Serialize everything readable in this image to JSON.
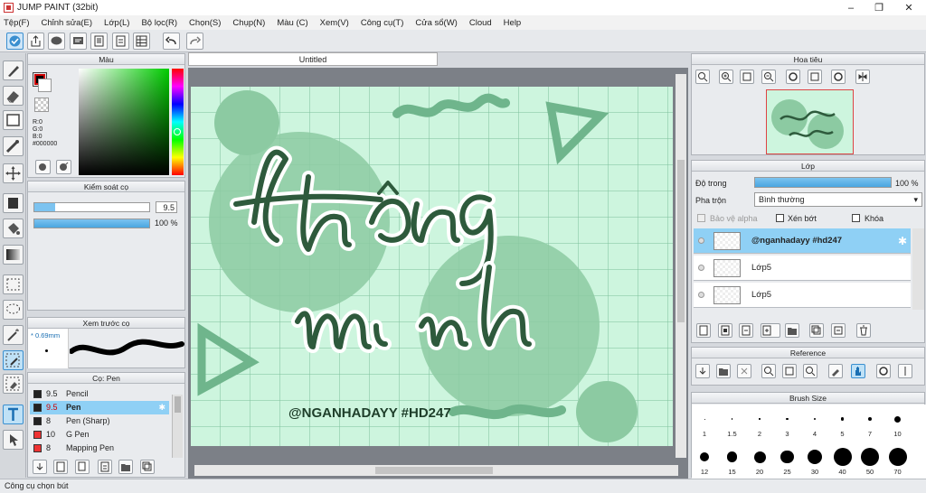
{
  "window": {
    "title": "JUMP PAINT (32bit)",
    "controls": [
      "minimize",
      "restore",
      "close"
    ]
  },
  "menu": [
    "Tệp(F)",
    "Chỉnh sửa(E)",
    "Lớp(L)",
    "Bộ lọc(R)",
    "Chọn(S)",
    "Chụp(N)",
    "Màu (C)",
    "Xem(V)",
    "Công cụ(T)",
    "Cửa sổ(W)",
    "Cloud",
    "Help"
  ],
  "document": {
    "tab_title": "Untitled"
  },
  "color_panel": {
    "title": "Màu",
    "r": "R:0",
    "g": "G:0",
    "b": "B:0",
    "hex": "#000000",
    "primary": "#000000",
    "secondary": "#ffffff"
  },
  "brush_control": {
    "title": "Kiểm soát cọ",
    "size": "9.5",
    "size_fraction": 0.18,
    "opacity": "100 %"
  },
  "brush_preview": {
    "title": "Xem trước cọ",
    "size_label": "* 0.69mm"
  },
  "brush_list": {
    "title": "Cọ: Pen",
    "items": [
      {
        "size": "9.5",
        "name": "Pencil",
        "color": "#222222",
        "selected": false
      },
      {
        "size": "9.5",
        "name": "Pen",
        "color": "#222222",
        "selected": true
      },
      {
        "size": "8",
        "name": "Pen (Sharp)",
        "color": "#222222",
        "selected": false
      },
      {
        "size": "10",
        "name": "G Pen",
        "color": "#ee3333",
        "selected": false
      },
      {
        "size": "8",
        "name": "Mapping Pen",
        "color": "#ee3333",
        "selected": false
      }
    ]
  },
  "navigator": {
    "title": "Hoa tiêu"
  },
  "layer_panel": {
    "title": "Lớp",
    "opacity_label": "Độ trong",
    "opacity": "100 %",
    "blend_label": "Pha trộn",
    "blend_mode": "Bình thường",
    "protect_alpha": "Bảo vệ alpha",
    "clipping": "Xén bớt",
    "lock": "Khóa",
    "layers": [
      {
        "name": "@nganhadayy #hd247",
        "selected": true
      },
      {
        "name": "Lớp5",
        "selected": false
      },
      {
        "name": "Lớp5",
        "selected": false
      }
    ]
  },
  "reference_panel": {
    "title": "Reference"
  },
  "brush_size_panel": {
    "title": "Brush Size",
    "sizes": [
      "1",
      "1.5",
      "2",
      "3",
      "4",
      "5",
      "7",
      "10",
      "12",
      "15",
      "20",
      "25",
      "30",
      "40",
      "50",
      "70"
    ]
  },
  "artwork": {
    "watermark": "@NGANHADAYY #HD247",
    "bg_color": "#cdf5de",
    "accent": "#8ccaa2",
    "stroke": "#2e5a3c"
  },
  "status": "Công cụ chọn bút",
  "icons": [
    "brush-icon",
    "eraser-icon",
    "select-rect-icon",
    "pen-icon",
    "move-icon",
    "fill-icon",
    "bucket-icon",
    "gradient-icon",
    "lasso-icon",
    "magic-wand-icon",
    "text-icon",
    "eyedropper-icon",
    "undo-icon",
    "redo-icon",
    "zoom-in-icon",
    "zoom-out-icon",
    "trash-icon",
    "gear-icon",
    "folder-icon"
  ]
}
